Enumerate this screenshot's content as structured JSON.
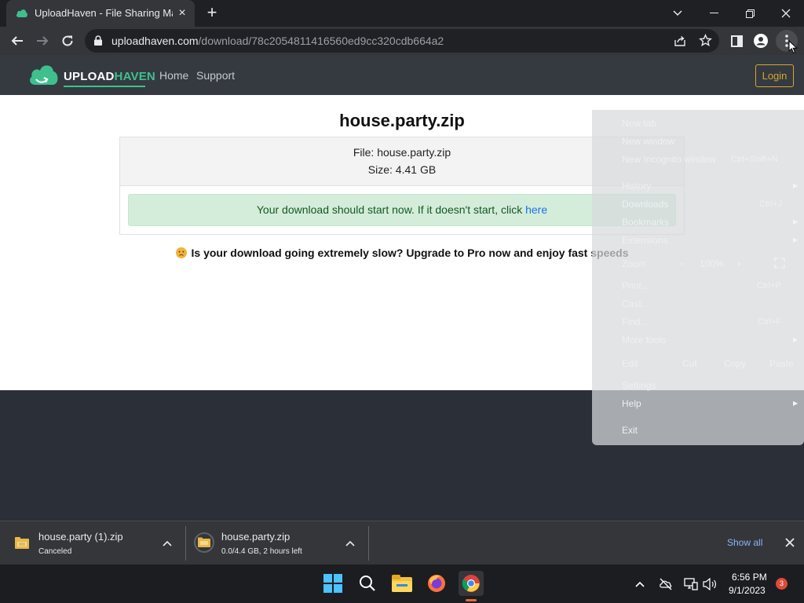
{
  "browser": {
    "tab_title": "UploadHaven - File Sharing Made Simple",
    "url_host": "uploadhaven.com",
    "url_path": "/download/78c2054811416560ed9cc320cdb664a2"
  },
  "site": {
    "logo_upload": "UPLOAD",
    "logo_haven": "HAVEN",
    "nav": {
      "home": "Home",
      "support": "Support"
    },
    "login_label": "Login",
    "accent_color": "#3ec08e"
  },
  "download_page": {
    "title": "house.party.zip",
    "file_line": "File: house.party.zip",
    "size_line": "Size: 4.41 GB",
    "alert_text": "Your download should start now. If it doesn't start, click ",
    "alert_link": "here",
    "slow_notice": "Is your download going extremely slow? Upgrade to Pro now and enjoy fast speeds"
  },
  "chrome_menu": {
    "new_tab": "New tab",
    "new_window": "New window",
    "new_incognito": "New Incognito window",
    "new_incognito_shortcut": "Ctrl+Shift+N",
    "history": "History",
    "downloads": "Downloads",
    "downloads_shortcut": "Ctrl+J",
    "bookmarks": "Bookmarks",
    "extensions": "Extensions",
    "zoom": "Zoom",
    "zoom_minus": "−",
    "zoom_value": "100%",
    "zoom_plus": "+",
    "print": "Print...",
    "print_shortcut": "Ctrl+P",
    "cast": "Cast...",
    "find": "Find...",
    "find_shortcut": "Ctrl+F",
    "more_tools": "More tools",
    "edit": "Edit",
    "cut": "Cut",
    "copy": "Copy",
    "paste": "Paste",
    "settings": "Settings",
    "help": "Help",
    "exit": "Exit"
  },
  "downloads_bar": {
    "items": [
      {
        "name": "house.party (1).zip",
        "status": "Canceled"
      },
      {
        "name": "house.party.zip",
        "status": "0.0/4.4 GB, 2 hours left"
      }
    ],
    "show_all": "Show all"
  },
  "taskbar": {
    "time": "6:56 PM",
    "date": "9/1/2023",
    "notification_count": "3"
  }
}
